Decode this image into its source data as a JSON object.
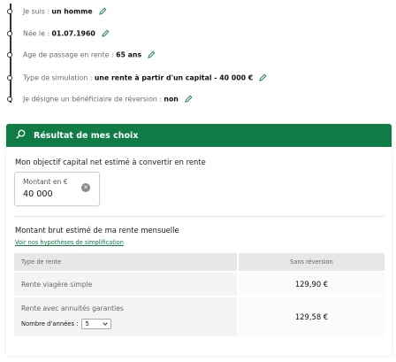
{
  "summary": {
    "items": [
      {
        "label": "Je suis :",
        "value": "un homme"
      },
      {
        "label": "Née le :",
        "value": "01.07.1960"
      },
      {
        "label": "Age de passage en rente :",
        "value": "65 ans"
      },
      {
        "label": "Type de simulation :",
        "value": "une rente à partir d'un capital - 40 000 €"
      },
      {
        "label": "Je désigne un bénéficiaire de réversion :",
        "value": "non"
      }
    ]
  },
  "result": {
    "title": "Résultat de  mes choix",
    "accent_color": "#0f7b45",
    "capital_label": "Mon objectif capital net estimé à convertir en rente",
    "amount_caption": "Montant en €",
    "amount_value": "40 000",
    "rent_label": "Montant brut estimé de ma rente mensuelle",
    "hypotheses_link": "Voir nos hypothèses de simplification",
    "table": {
      "headers": [
        "Type de rente",
        "Sans réversion"
      ],
      "rows": [
        {
          "label": "Rente viagère simple",
          "value": "129,90 €"
        },
        {
          "label": "Rente avec annuités garanties",
          "value": "129,58 €",
          "years_label": "Nombre d'années :",
          "years_value": "5"
        }
      ]
    }
  }
}
